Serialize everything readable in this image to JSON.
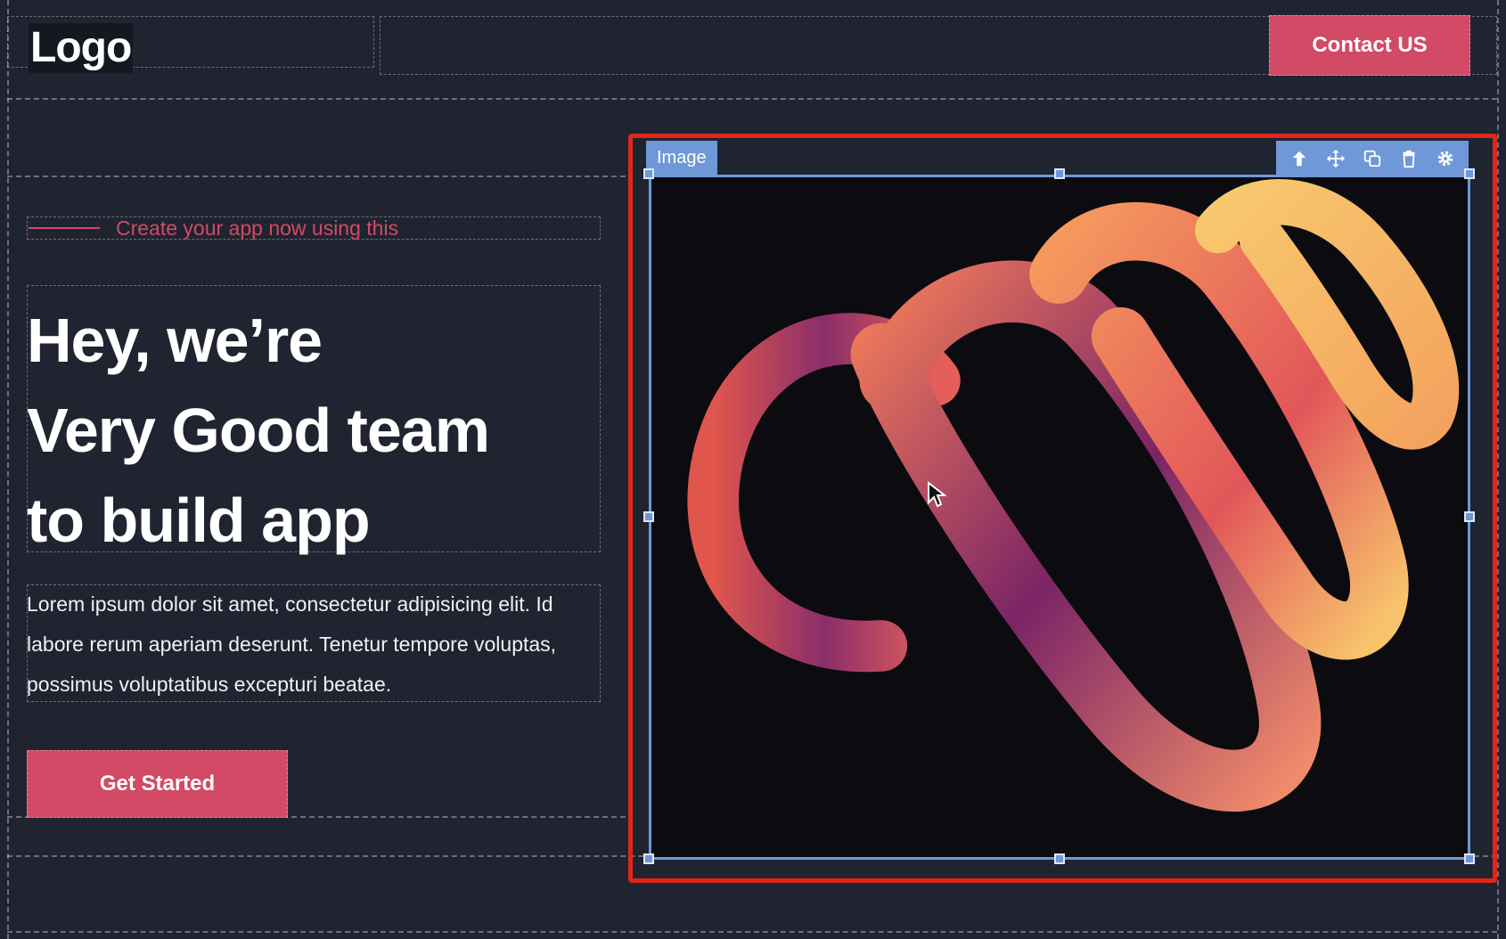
{
  "header": {
    "logo": "Logo",
    "contact_label": "Contact US"
  },
  "hero": {
    "tagline": "Create your app now using this",
    "headline": [
      "Hey, we’re",
      "Very Good team",
      "to build app"
    ],
    "paragraph": "Lorem ipsum dolor sit amet, consectetur adipisicing elit. Id labore rerum aperiam deserunt. Tenetur tempore voluptas, possimus voluptatibus excepturi beatae.",
    "cta_label": "Get Started"
  },
  "editor": {
    "selected_element_label": "Image",
    "toolbar_icons": [
      "arrow-up-icon",
      "move-icon",
      "duplicate-icon",
      "trash-icon",
      "gear-icon"
    ],
    "selection_color": "#e0261c",
    "frame_color": "#6e98d8"
  },
  "colors": {
    "background": "#1f2430",
    "accent": "#d24a66"
  }
}
